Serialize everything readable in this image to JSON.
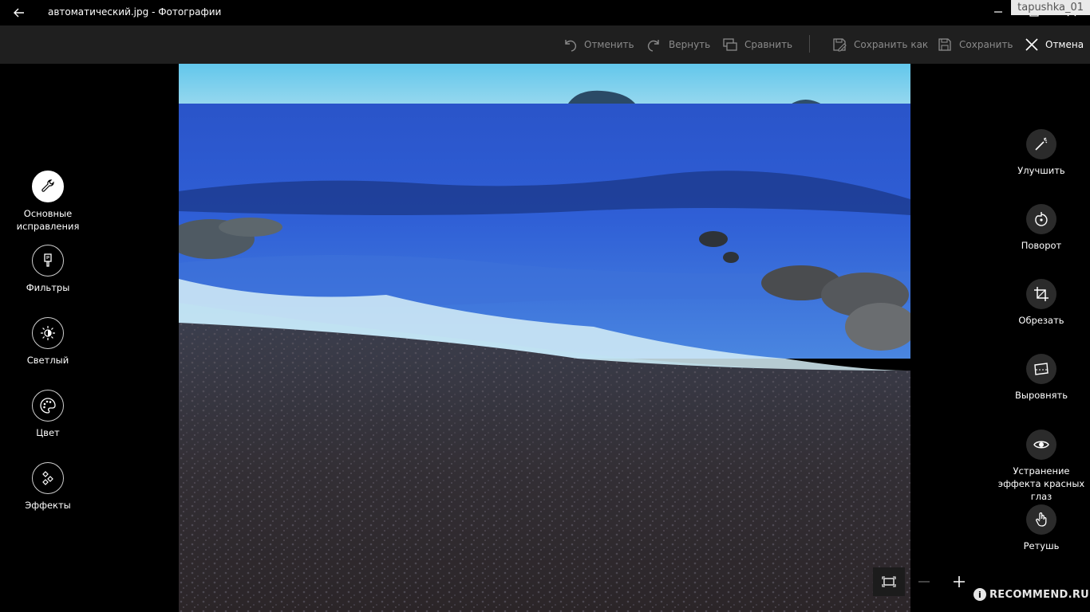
{
  "window": {
    "title": "автоматический.jpg - Фотографии",
    "user_tag": "tapushka_01"
  },
  "toolbar": {
    "undo_label": "Отменить",
    "redo_label": "Вернуть",
    "compare_label": "Сравнить",
    "save_as_label": "Сохранить как",
    "save_label": "Сохранить",
    "cancel_label": "Отмена"
  },
  "left_tools": [
    {
      "label": "Основные исправления",
      "icon": "wrench-icon",
      "selected": true
    },
    {
      "label": "Фильтры",
      "icon": "brush-icon"
    },
    {
      "label": "Светлый",
      "icon": "brightness-icon"
    },
    {
      "label": "Цвет",
      "icon": "palette-icon"
    },
    {
      "label": "Эффекты",
      "icon": "effects-icon"
    }
  ],
  "right_tools": [
    {
      "label": "Улучшить",
      "icon": "magic-wand-icon"
    },
    {
      "label": "Поворот",
      "icon": "rotate-icon"
    },
    {
      "label": "Обрезать",
      "icon": "crop-icon"
    },
    {
      "label": "Выровнять",
      "icon": "straighten-icon"
    },
    {
      "label": "Устранение эффекта красных глаз",
      "icon": "eye-icon"
    },
    {
      "label": "Ретушь",
      "icon": "hand-icon"
    }
  ],
  "watermark": {
    "text": "RECOMMEND.RU",
    "badge": "i"
  },
  "colors": {
    "background": "#000000",
    "toolbar": "#1f1f1f",
    "disabled_text": "#8a8a8a"
  }
}
